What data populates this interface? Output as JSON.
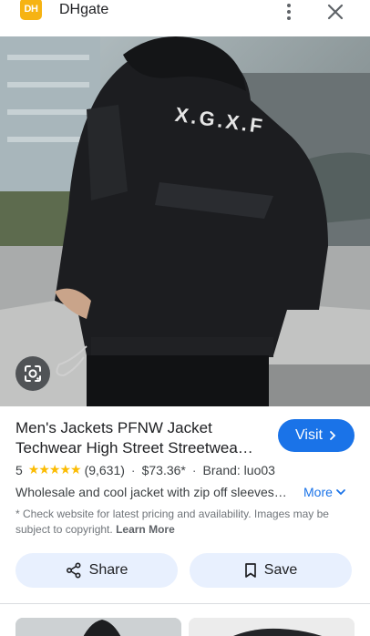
{
  "header": {
    "logo_text": "DH",
    "site_name": "DHgate",
    "menu_icon": "more-vert-icon",
    "close_icon": "close-icon"
  },
  "image": {
    "jacket_print": "X.G.X.F",
    "lens_icon": "google-lens-icon"
  },
  "product": {
    "title_line1": "Men's Jackets PFNW Jacket",
    "title_line2": "Techwear High Street Streetwea…",
    "rating": "5",
    "stars": "★★★★★",
    "reviews": "(9,631)",
    "dot": "·",
    "price": "$73.36*",
    "brand": "Brand: luo03",
    "description": "Wholesale and cool jacket with zip off sleeves…",
    "more_label": "More",
    "note": "* Check website for latest pricing and availability. Images may be subject to copyright.",
    "learn_more": "Learn More"
  },
  "actions": {
    "visit_label": "Visit",
    "share_label": "Share",
    "save_label": "Save"
  },
  "colors": {
    "accent": "#1a73e8",
    "pill_bg": "#e8f0fe",
    "star": "#fbbc04",
    "logo": "#f6b313"
  }
}
